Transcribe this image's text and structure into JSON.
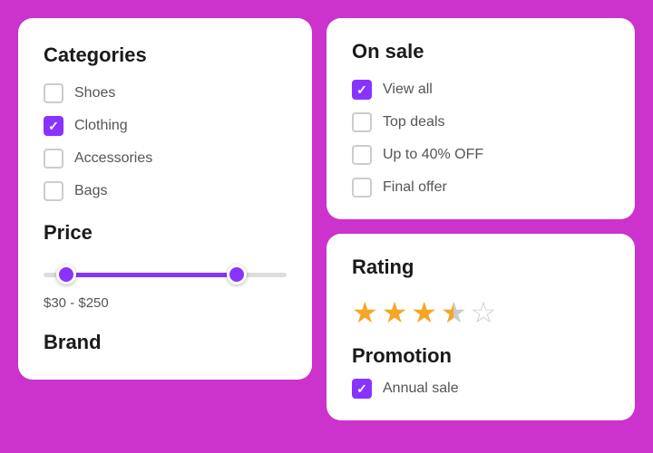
{
  "left_card": {
    "categories_title": "Categories",
    "items": [
      {
        "label": "Shoes",
        "checked": false
      },
      {
        "label": "Clothing",
        "checked": true
      },
      {
        "label": "Accessories",
        "checked": false
      },
      {
        "label": "Bags",
        "checked": false
      }
    ],
    "price_title": "Price",
    "price_range": "$30 - $250",
    "price_min": 30,
    "price_max": 250,
    "brand_title": "Brand"
  },
  "on_sale_card": {
    "title": "On sale",
    "items": [
      {
        "label": "View all",
        "checked": true
      },
      {
        "label": "Top deals",
        "checked": false
      },
      {
        "label": "Up to 40% OFF",
        "checked": false
      },
      {
        "label": "Final offer",
        "checked": false
      }
    ]
  },
  "rating_card": {
    "title": "Rating",
    "stars": [
      {
        "type": "filled"
      },
      {
        "type": "filled"
      },
      {
        "type": "filled"
      },
      {
        "type": "half"
      },
      {
        "type": "empty"
      }
    ]
  },
  "promotion_card": {
    "title": "Promotion",
    "items": [
      {
        "label": "Annual sale",
        "checked": true
      }
    ]
  }
}
